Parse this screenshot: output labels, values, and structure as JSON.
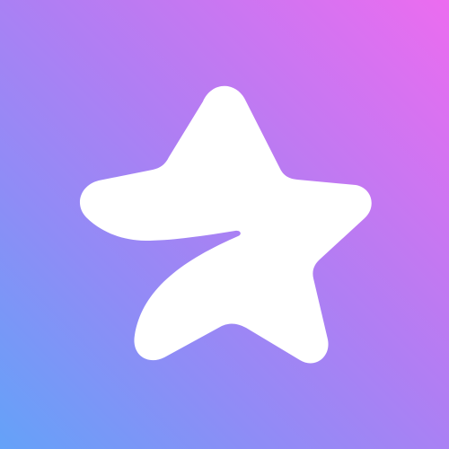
{
  "app_icon": {
    "icon": "premium-star-icon",
    "colors": {
      "gradient_top_right": "#ec6cf0",
      "gradient_middle": "#b07ef3",
      "gradient_lower": "#8f8cf6",
      "gradient_bottom_left": "#64a2f8",
      "star_fill": "#ffffff"
    }
  }
}
